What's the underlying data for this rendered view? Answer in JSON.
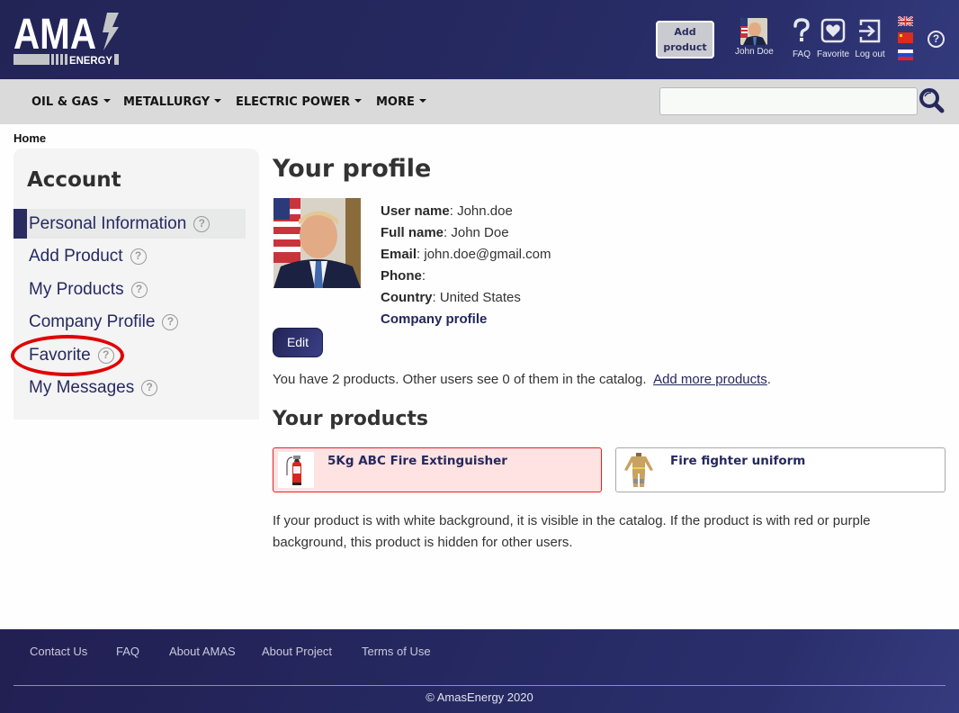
{
  "header": {
    "logo": {
      "main": "AMA",
      "sub": "ENERGY"
    },
    "add_product_label_line1": "Add",
    "add_product_label_line2": "product",
    "user": {
      "name": "John Doe",
      "icon": "avatar"
    },
    "actions": [
      {
        "label": "FAQ",
        "icon": "question-mark-icon"
      },
      {
        "label": "Favorite",
        "icon": "heart-icon"
      },
      {
        "label": "Log out",
        "icon": "logout-icon"
      }
    ],
    "languages": [
      {
        "code": "en",
        "icon": "uk-flag-icon"
      },
      {
        "code": "zh",
        "icon": "china-flag-icon"
      },
      {
        "code": "ru",
        "icon": "russia-flag-icon"
      }
    ],
    "help_icon": "help-circle-icon"
  },
  "nav": {
    "items": [
      {
        "label": "OIL & GAS"
      },
      {
        "label": "METALLURGY"
      },
      {
        "label": "ELECTRIC POWER"
      },
      {
        "label": "MORE"
      }
    ],
    "search": {
      "value": "",
      "placeholder": ""
    }
  },
  "breadcrumb": {
    "home": "Home"
  },
  "sidebar": {
    "title": "Account",
    "items": [
      {
        "label": "Personal Information",
        "active": true
      },
      {
        "label": "Add Product"
      },
      {
        "label": "My Products"
      },
      {
        "label": "Company Profile"
      },
      {
        "label": "Favorite",
        "annotated": true
      },
      {
        "label": "My Messages"
      }
    ],
    "help_glyph": "?"
  },
  "profile": {
    "title": "Your profile",
    "fields": [
      {
        "label": "User name",
        "value": "John.doe"
      },
      {
        "label": "Full name",
        "value": "John Doe"
      },
      {
        "label": "Email",
        "value": "john.doe@gmail.com"
      },
      {
        "label": "Phone",
        "value": ""
      },
      {
        "label": "Country",
        "value": "United States"
      }
    ],
    "company_link": "Company profile",
    "edit_label": "Edit",
    "summary_text": "You have 2 products. Other users see 0 of them in the catalog.",
    "summary_link": "Add more products",
    "summary_end": "."
  },
  "products": {
    "title": "Your products",
    "items": [
      {
        "name": "5Kg ABC Fire Extinguisher",
        "status": "hidden",
        "bg_color": "#ffe2e2",
        "border_color": "#e52222"
      },
      {
        "name": "Fire fighter uniform",
        "status": "visible",
        "bg_color": "#ffffff",
        "border_color": "#a9a9a9"
      }
    ],
    "note": "If your product is with white background, it is visible in the catalog. If the product is with red or purple background, this product is hidden for other users."
  },
  "footer": {
    "links": [
      {
        "label": "Contact Us"
      },
      {
        "label": "FAQ"
      },
      {
        "label": "About AMAS"
      },
      {
        "label": "About Project"
      },
      {
        "label": "Terms of Use"
      }
    ],
    "copyright": "© AmasEnergy 2020"
  },
  "colors": {
    "brand_navy": "#25285e",
    "nav_bg": "#d9dad9",
    "annotation_red": "#e00000"
  }
}
